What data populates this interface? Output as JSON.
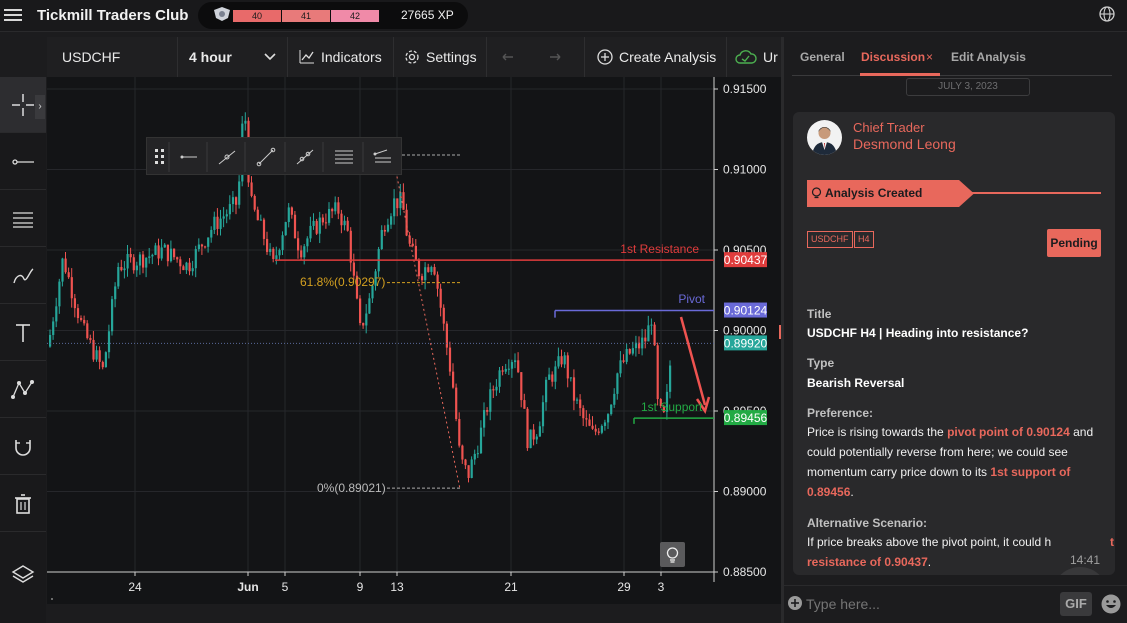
{
  "app": {
    "title": "Tickmill Traders Club",
    "xp_levels": [
      "40",
      "41",
      "42"
    ],
    "xp_total": "27665 XP"
  },
  "toolbar": {
    "symbol": "USDCHF",
    "interval": "4 hour",
    "indicators_label": "Indicators",
    "settings_label": "Settings",
    "create_analysis_label": "Create Analysis",
    "truncated_label": "Ur"
  },
  "left_tools": [
    "crosshair-icon",
    "horizontal-ray-icon",
    "fibonacci-icon",
    "brush-icon",
    "text-tool-icon",
    "pattern-icon",
    "magnet-icon",
    "trash-icon",
    "layers-icon"
  ],
  "chart_data": {
    "type": "candlestick",
    "symbol": "USDCHF",
    "interval": "4 hour",
    "y_ticks": [
      "0.91500",
      "0.91000",
      "0.90500",
      "0.90000",
      "0.89500",
      "0.89000",
      "0.88500"
    ],
    "x_ticks": [
      "24",
      "Jun",
      "5",
      "9",
      "13",
      "21",
      "29",
      "3"
    ],
    "ylim": [
      0.885,
      0.915
    ],
    "price_labels": [
      {
        "text": "0.90437",
        "value": 0.90437,
        "color": "#e03c3c"
      },
      {
        "text": "0.90124",
        "value": 0.90124,
        "color": "#6a6ad8"
      },
      {
        "text": "0.89920",
        "value": 0.8992,
        "color": "#26a69a"
      },
      {
        "text": "0.89456",
        "value": 0.89456,
        "color": "#22aa44"
      }
    ],
    "annotations": [
      {
        "text": "1st Resistance",
        "value": 0.90437,
        "color": "#e03c3c"
      },
      {
        "text": "Pivot",
        "value": 0.90124,
        "color": "#6a6ad8"
      },
      {
        "text": "1st Support",
        "value": 0.89456,
        "color": "#22aa44"
      },
      {
        "text": "61.8%(0.90297)",
        "value": 0.90297,
        "color": "#d4a020"
      },
      {
        "text": "0%(0.89021)",
        "value": 0.89021,
        "color": "#bbbbbb"
      }
    ]
  },
  "panel": {
    "tabs": [
      "General",
      "Discussion",
      "Edit Analysis"
    ],
    "date": "JULY 3, 2023",
    "role": "Chief Trader",
    "author": "Desmond Leong",
    "status_banner": "Analysis Created",
    "tags": [
      "USDCHF",
      "H4"
    ],
    "status": "Pending",
    "title_label": "Title",
    "title_value": "USDCHF H4 | Heading into resistance?",
    "type_label": "Type",
    "type_value": "Bearish Reversal",
    "preference_label": "Preference:",
    "pref_a": "Price is rising towards the ",
    "pref_b": "pivot point of 0.90124",
    "pref_c": " and could potentially reverse from here; we could see momentum carry price down to its ",
    "pref_d": "1st support of 0.89456",
    "pref_e": ".",
    "alt_label": "Alternative Scenario:",
    "alt_a": "If price breaks above the pivot point, it could h",
    "alt_b": "t",
    "alt_c": "resistance of 0.90437",
    "alt_d": ".",
    "time": "14:41",
    "input_placeholder": "Type here...",
    "gif_label": "GIF"
  }
}
